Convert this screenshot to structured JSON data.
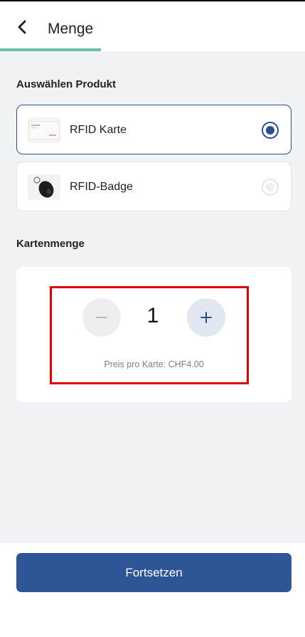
{
  "header": {
    "title": "Menge",
    "back_icon": "chevron-left-icon",
    "progress_fraction": 0.33
  },
  "products": {
    "section_label": "Auswählen Produkt",
    "items": [
      {
        "label": "RFID Karte",
        "image": "rfid-card-image",
        "selected": true
      },
      {
        "label": "RFID-Badge",
        "image": "rfid-badge-image",
        "selected": false
      }
    ]
  },
  "quantity": {
    "section_label": "Kartenmenge",
    "value": "1",
    "minus_icon": "minus-icon",
    "plus_icon": "plus-icon",
    "price_text": "Preis pro Karte: CHF4.00"
  },
  "footer": {
    "continue_label": "Fortsetzen"
  },
  "colors": {
    "accent": "#2e5697",
    "progress": "#6cbfa8",
    "highlight": "#e00000"
  }
}
